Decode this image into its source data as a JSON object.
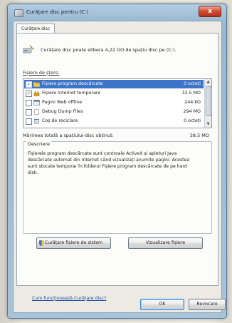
{
  "window": {
    "title": "Curățare disc pentru (C:)"
  },
  "tab": {
    "label": "Curățare disc"
  },
  "header": {
    "text": "Curățare disc poate elibera 4,22 GO de spațiu disc pe (C:)."
  },
  "files_section": {
    "label": "Fișiere de șters:"
  },
  "file_list": [
    {
      "checked": true,
      "name": "Fișiere program descărcate",
      "size": "0 octeți",
      "selected": true
    },
    {
      "checked": true,
      "name": "Fișiere Internet temporare",
      "size": "32,5 MO"
    },
    {
      "checked": false,
      "name": "Pagini Web offline",
      "size": "244 KO"
    },
    {
      "checked": false,
      "name": "Debug Dump Files",
      "size": "294 MO"
    },
    {
      "checked": false,
      "name": "Coș de reciclare",
      "size": "0 octeți"
    }
  ],
  "total": {
    "label": "Mărimea totală a spațiului-disc obținut:",
    "value": "38,5 MO"
  },
  "description": {
    "legend": "Descriere",
    "text": "Fișierele program descărcate sunt controale ActiveX și apleturi Java descărcate automat din Internet când vizualizați anumite pagini. Acestea sunt stocate temporar în folderul Fișiere program descărcate de pe hard disk."
  },
  "buttons": {
    "clean_system": "Curățare fișiere de sistem",
    "view_files": "Vizualizare fișiere",
    "ok": "OK",
    "cancel": "Revocare",
    "close": "x"
  },
  "help_link": "Cum funcționează Curățare disc?",
  "colors": {
    "selection": "#3b74c9",
    "close": "#cf4b30",
    "link": "#1c4fa0"
  }
}
